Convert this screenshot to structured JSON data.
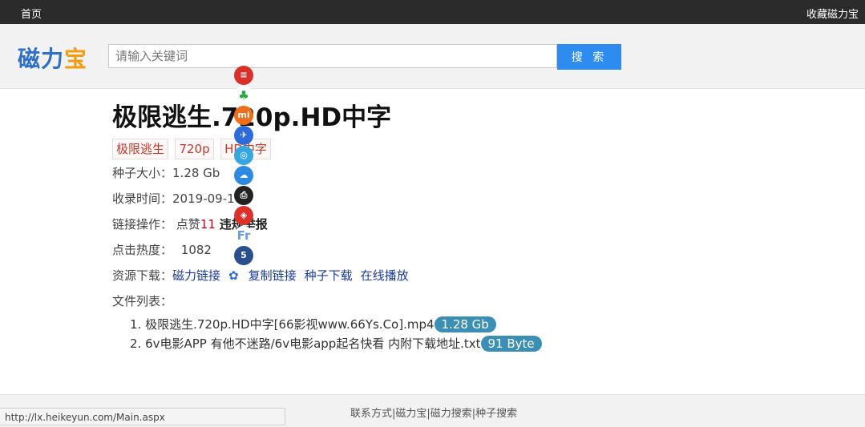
{
  "topbar": {
    "home": "首页",
    "favorite": "收藏磁力宝"
  },
  "header": {
    "logo": {
      "part1": "磁",
      "part2": "力",
      "part3": "宝"
    },
    "search_placeholder": "请输入关键词",
    "search_button": "搜 索"
  },
  "detail": {
    "title": "极限逃生.720p.HD中字",
    "tags": [
      "极限逃生",
      "720p",
      "HD中字"
    ],
    "size_label": "种子大小：",
    "size_value": "1.28 Gb",
    "date_label": "收录时间：",
    "date_value": "2019-09-10",
    "ops_label": "链接操作：",
    "like_text": "点赞",
    "like_count": "11",
    "report_text": "违规举报",
    "hits_label": "点击热度：",
    "hits_value": "1082",
    "download_label": "资源下载：",
    "magnet_link": "磁力链接",
    "copy_link": "复制链接",
    "torrent_download": "种子下载",
    "online_play": "在线播放",
    "files_label": "文件列表："
  },
  "files": [
    {
      "name": "1. 极限逃生.720p.HD中字[66影视www.66Ys.Co].mp4",
      "size": "1.28 Gb"
    },
    {
      "name": "2. 6v电影APP 有他不迷路/6v电影app起名快看 内附下载地址.txt",
      "size": "91 Byte"
    }
  ],
  "share_icons": [
    {
      "name": "qzone-icon",
      "color": "#d9302b",
      "glyph": "≡"
    },
    {
      "name": "wechat-icon",
      "color": "#ffffff",
      "glyph": "♣"
    },
    {
      "name": "xiaomi-icon",
      "color": "#f06d1a",
      "glyph": "mi"
    },
    {
      "name": "tieba-icon",
      "color": "#2d6bd8",
      "glyph": "✈"
    },
    {
      "name": "qq-icon",
      "color": "#37a6e0",
      "glyph": "◎"
    },
    {
      "name": "cloud-icon",
      "color": "#2d8ae0",
      "glyph": "☁"
    },
    {
      "name": "print-icon",
      "color": "#222222",
      "glyph": "⎙"
    },
    {
      "name": "weibo-icon",
      "color": "#d8322b",
      "glyph": "◈"
    },
    {
      "name": "friendfeed-icon",
      "color": "#ffffff",
      "glyph": "Fr"
    },
    {
      "name": "five-icon",
      "color": "#2a4f8f",
      "glyph": "5"
    }
  ],
  "footer": {
    "links": "联系方式|磁力宝|磁力搜索|种子搜索"
  },
  "status_url": "http://lx.heikeyun.com/Main.aspx"
}
